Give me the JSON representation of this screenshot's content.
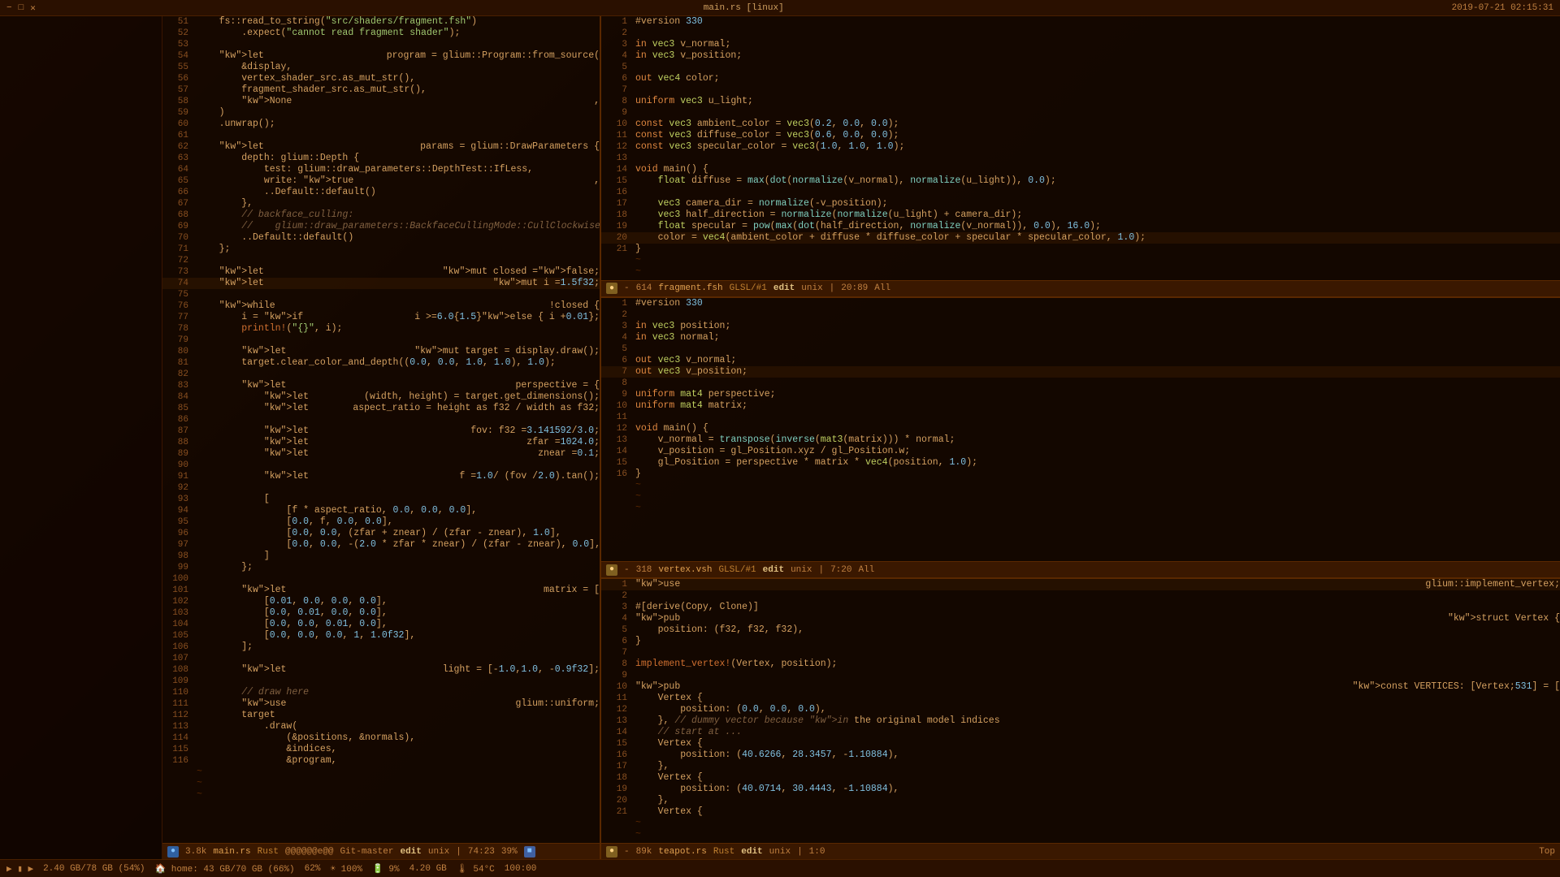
{
  "window": {
    "title": "main.rs [linux]",
    "datetime": "2019-07-21 02:15:31"
  },
  "topbar": {
    "left_controls": [
      "−",
      "□",
      "✕"
    ],
    "title": "main.rs [linux]",
    "datetime": "2019-07-21 02:15:31"
  },
  "bottombar": {
    "items": [
      "▶ ▮ ▶",
      "2.40 GB/78 GB (54%)",
      "home: 43 GB/70 GB (66%)",
      "62%",
      "100%",
      "9%",
      "4.20 GB",
      "54°C",
      "100:00"
    ]
  },
  "left_pane": {
    "status": {
      "indicator": "●",
      "indicator_color": "blue",
      "size": "3.8k",
      "filename": "main.rs",
      "filetype": "Rust",
      "flags": "@@@@@@e@@",
      "branch": "Git-master",
      "mode": "edit",
      "encoding": "unix",
      "position": "74:23",
      "percent": "39%",
      "indicator2": "■"
    },
    "lines": [
      {
        "num": 51,
        "content": "    fs::read_to_string(\"src/shaders/fragment.fsh\")"
      },
      {
        "num": 52,
        "content": "        .expect(\"cannot read fragment shader\");"
      },
      {
        "num": 53,
        "content": ""
      },
      {
        "num": 54,
        "content": "    let program = glium::Program::from_source("
      },
      {
        "num": 55,
        "content": "        &display,"
      },
      {
        "num": 56,
        "content": "        vertex_shader_src.as_mut_str(),"
      },
      {
        "num": 57,
        "content": "        fragment_shader_src.as_mut_str(),"
      },
      {
        "num": 58,
        "content": "        None,"
      },
      {
        "num": 59,
        "content": "    )"
      },
      {
        "num": 60,
        "content": "    .unwrap();"
      },
      {
        "num": 61,
        "content": ""
      },
      {
        "num": 62,
        "content": "    let params = glium::DrawParameters {"
      },
      {
        "num": 63,
        "content": "        depth: glium::Depth {"
      },
      {
        "num": 64,
        "content": "            test: glium::draw_parameters::DepthTest::IfLess,"
      },
      {
        "num": 65,
        "content": "            write: true,"
      },
      {
        "num": 66,
        "content": "            ..Default::default()"
      },
      {
        "num": 67,
        "content": "        },"
      },
      {
        "num": 68,
        "content": "        // backface_culling:"
      },
      {
        "num": 69,
        "content": "        //    glium::draw_parameters::BackfaceCullingMode::CullClockwise,"
      },
      {
        "num": 70,
        "content": "        ..Default::default()"
      },
      {
        "num": 71,
        "content": "    };"
      },
      {
        "num": 72,
        "content": ""
      },
      {
        "num": 73,
        "content": "    let mut closed = false;"
      },
      {
        "num": 74,
        "content": "    let mut i = 1.5f32;"
      },
      {
        "num": 75,
        "content": ""
      },
      {
        "num": 76,
        "content": "    while !closed {"
      },
      {
        "num": 77,
        "content": "        i = if i >= 6.0 { 1.5 } else { i + 0.01 };"
      },
      {
        "num": 78,
        "content": "        println!(\"{}\", i);"
      },
      {
        "num": 79,
        "content": ""
      },
      {
        "num": 80,
        "content": "        let mut target = display.draw();"
      },
      {
        "num": 81,
        "content": "        target.clear_color_and_depth((0.0, 0.0, 1.0, 1.0), 1.0);"
      },
      {
        "num": 82,
        "content": ""
      },
      {
        "num": 83,
        "content": "        let perspective = {"
      },
      {
        "num": 84,
        "content": "            let (width, height) = target.get_dimensions();"
      },
      {
        "num": 85,
        "content": "            let aspect_ratio = height as f32 / width as f32;"
      },
      {
        "num": 86,
        "content": ""
      },
      {
        "num": 87,
        "content": "            let fov: f32 = 3.141592 / 3.0;"
      },
      {
        "num": 88,
        "content": "            let zfar = 1024.0;"
      },
      {
        "num": 89,
        "content": "            let znear = 0.1;"
      },
      {
        "num": 90,
        "content": ""
      },
      {
        "num": 91,
        "content": "            let f = 1.0 / (fov / 2.0).tan();"
      },
      {
        "num": 92,
        "content": ""
      },
      {
        "num": 93,
        "content": "            ["
      },
      {
        "num": 94,
        "content": "                [f * aspect_ratio, 0.0, 0.0, 0.0],"
      },
      {
        "num": 95,
        "content": "                [0.0, f, 0.0, 0.0],"
      },
      {
        "num": 96,
        "content": "                [0.0, 0.0, (zfar + znear) / (zfar - znear), 1.0],"
      },
      {
        "num": 97,
        "content": "                [0.0, 0.0, -(2.0 * zfar * znear) / (zfar - znear), 0.0],"
      },
      {
        "num": 98,
        "content": "            ]"
      },
      {
        "num": 99,
        "content": "        };"
      },
      {
        "num": 100,
        "content": ""
      },
      {
        "num": 101,
        "content": "        let matrix = ["
      },
      {
        "num": 102,
        "content": "            [0.01, 0.0, 0.0, 0.0],"
      },
      {
        "num": 103,
        "content": "            [0.0, 0.01, 0.0, 0.0],"
      },
      {
        "num": 104,
        "content": "            [0.0, 0.0, 0.01, 0.0],"
      },
      {
        "num": 105,
        "content": "            [0.0, 0.0, 0.0, 1, 1.0f32],"
      },
      {
        "num": 106,
        "content": "        ];"
      },
      {
        "num": 107,
        "content": ""
      },
      {
        "num": 108,
        "content": "        let light = [-1.0, 1.0, -0.9f32];"
      },
      {
        "num": 109,
        "content": ""
      },
      {
        "num": 110,
        "content": "        // draw here"
      },
      {
        "num": 111,
        "content": "        use glium::uniform;"
      },
      {
        "num": 112,
        "content": "        target"
      },
      {
        "num": 113,
        "content": "            .draw("
      },
      {
        "num": 114,
        "content": "                (&positions, &normals),"
      },
      {
        "num": 115,
        "content": "                &indices,"
      },
      {
        "num": 116,
        "content": "                &program,"
      }
    ]
  },
  "right_top_pane": {
    "status": {
      "indicator": "●",
      "indicator_color": "yellow",
      "size": "614",
      "filename": "fragment.fsh",
      "filetype": "GLSL/#1",
      "mode": "edit",
      "encoding": "unix",
      "position": "20:89",
      "modifier": "All"
    },
    "lines": [
      {
        "num": 1,
        "content": "#version 330"
      },
      {
        "num": 2,
        "content": ""
      },
      {
        "num": 3,
        "content": "in vec3 v_normal;"
      },
      {
        "num": 4,
        "content": "in vec3 v_position;"
      },
      {
        "num": 5,
        "content": ""
      },
      {
        "num": 6,
        "content": "out vec4 color;"
      },
      {
        "num": 7,
        "content": ""
      },
      {
        "num": 8,
        "content": "uniform vec3 u_light;"
      },
      {
        "num": 9,
        "content": ""
      },
      {
        "num": 10,
        "content": "const vec3 ambient_color = vec3(0.2, 0.0, 0.0);"
      },
      {
        "num": 11,
        "content": "const vec3 diffuse_color = vec3(0.6, 0.0, 0.0);"
      },
      {
        "num": 12,
        "content": "const vec3 specular_color = vec3(1.0, 1.0, 1.0);"
      },
      {
        "num": 13,
        "content": ""
      },
      {
        "num": 14,
        "content": "void main() {"
      },
      {
        "num": 15,
        "content": "    float diffuse = max(dot(normalize(v_normal), normalize(u_light)), 0.0);"
      },
      {
        "num": 16,
        "content": ""
      },
      {
        "num": 17,
        "content": "    vec3 camera_dir = normalize(-v_position);"
      },
      {
        "num": 18,
        "content": "    vec3 half_direction = normalize(normalize(u_light) + camera_dir);"
      },
      {
        "num": 19,
        "content": "    float specular = pow(max(dot(half_direction, normalize(v_normal)), 0.0), 16.0);"
      },
      {
        "num": 20,
        "content": "    color = vec4(ambient_color + diffuse * diffuse_color + specular * specular_color, 1.0);"
      },
      {
        "num": 21,
        "content": "}"
      }
    ]
  },
  "right_middle_pane": {
    "status": {
      "indicator": "●",
      "indicator_color": "yellow",
      "size": "318",
      "filename": "vertex.vsh",
      "filetype": "GLSL/#1",
      "mode": "edit",
      "encoding": "unix",
      "position": "7:20",
      "modifier": "All"
    },
    "lines": [
      {
        "num": 1,
        "content": "#version 330"
      },
      {
        "num": 2,
        "content": ""
      },
      {
        "num": 3,
        "content": "in vec3 position;"
      },
      {
        "num": 4,
        "content": "in vec3 normal;"
      },
      {
        "num": 5,
        "content": ""
      },
      {
        "num": 6,
        "content": "out vec3 v_normal;"
      },
      {
        "num": 7,
        "content": "out vec3 v_position;"
      },
      {
        "num": 8,
        "content": ""
      },
      {
        "num": 9,
        "content": "uniform mat4 perspective;"
      },
      {
        "num": 10,
        "content": "uniform mat4 matrix;"
      },
      {
        "num": 11,
        "content": ""
      },
      {
        "num": 12,
        "content": "void main() {"
      },
      {
        "num": 13,
        "content": "    v_normal = transpose(inverse(mat3(matrix))) * normal;"
      },
      {
        "num": 14,
        "content": "    v_position = gl_Position.xyz / gl_Position.w;"
      },
      {
        "num": 15,
        "content": "    gl_Position = perspective * matrix * vec4(position, 1.0);"
      },
      {
        "num": 16,
        "content": "}"
      }
    ]
  },
  "right_bottom_pane": {
    "status": {
      "indicator": "●",
      "indicator_color": "yellow",
      "size": "89k",
      "filename": "teapot.rs",
      "filetype": "Rust",
      "mode": "edit",
      "encoding": "unix",
      "position": "1:0",
      "modifier": "Top"
    },
    "lines": [
      {
        "num": 1,
        "content": "use glium::implement_vertex;"
      },
      {
        "num": 2,
        "content": ""
      },
      {
        "num": 3,
        "content": "#[derive(Copy, Clone)]"
      },
      {
        "num": 4,
        "content": "pub struct Vertex {"
      },
      {
        "num": 5,
        "content": "    position: (f32, f32, f32),"
      },
      {
        "num": 6,
        "content": "}"
      },
      {
        "num": 7,
        "content": ""
      },
      {
        "num": 8,
        "content": "implement_vertex!(Vertex, position);"
      },
      {
        "num": 9,
        "content": ""
      },
      {
        "num": 10,
        "content": "pub const VERTICES: [Vertex; 531] = ["
      },
      {
        "num": 11,
        "content": "    Vertex {"
      },
      {
        "num": 12,
        "content": "        position: (0.0, 0.0, 0.0),"
      },
      {
        "num": 13,
        "content": "    }, // dummy vector because in the original model indices"
      },
      {
        "num": 14,
        "content": "    // start at ..."
      },
      {
        "num": 15,
        "content": "    Vertex {"
      },
      {
        "num": 16,
        "content": "        position: (40.6266, 28.3457, -1.10884),"
      },
      {
        "num": 17,
        "content": "    },"
      },
      {
        "num": 18,
        "content": "    Vertex {"
      },
      {
        "num": 19,
        "content": "        position: (40.0714, 30.4443, -1.10884),"
      },
      {
        "num": 20,
        "content": "    },"
      },
      {
        "num": 21,
        "content": "    Vertex {"
      }
    ]
  },
  "tilde_char": "~",
  "labels": {
    "top_button_min": "−",
    "top_button_max": "□",
    "top_button_close": "✕"
  }
}
